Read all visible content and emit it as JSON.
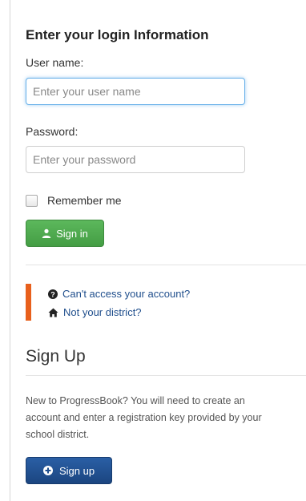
{
  "login": {
    "title": "Enter your login Information",
    "username_label": "User name:",
    "username_placeholder": "Enter your user name",
    "password_label": "Password:",
    "password_placeholder": "Enter your password",
    "remember_label": "Remember me",
    "signin_label": "Sign in",
    "signin_color": "#5cb85c"
  },
  "help": {
    "accent_color": "#e8601c",
    "links": [
      {
        "label": "Can't access your account?",
        "icon": "question-circle-icon"
      },
      {
        "label": "Not your district?",
        "icon": "home-icon"
      }
    ]
  },
  "signup": {
    "title": "Sign Up",
    "description": "New to ProgressBook? You will need to create an\naccount and enter a registration key provided by your\nschool district.",
    "button_label": "Sign up",
    "button_color": "#1f4f8f"
  }
}
